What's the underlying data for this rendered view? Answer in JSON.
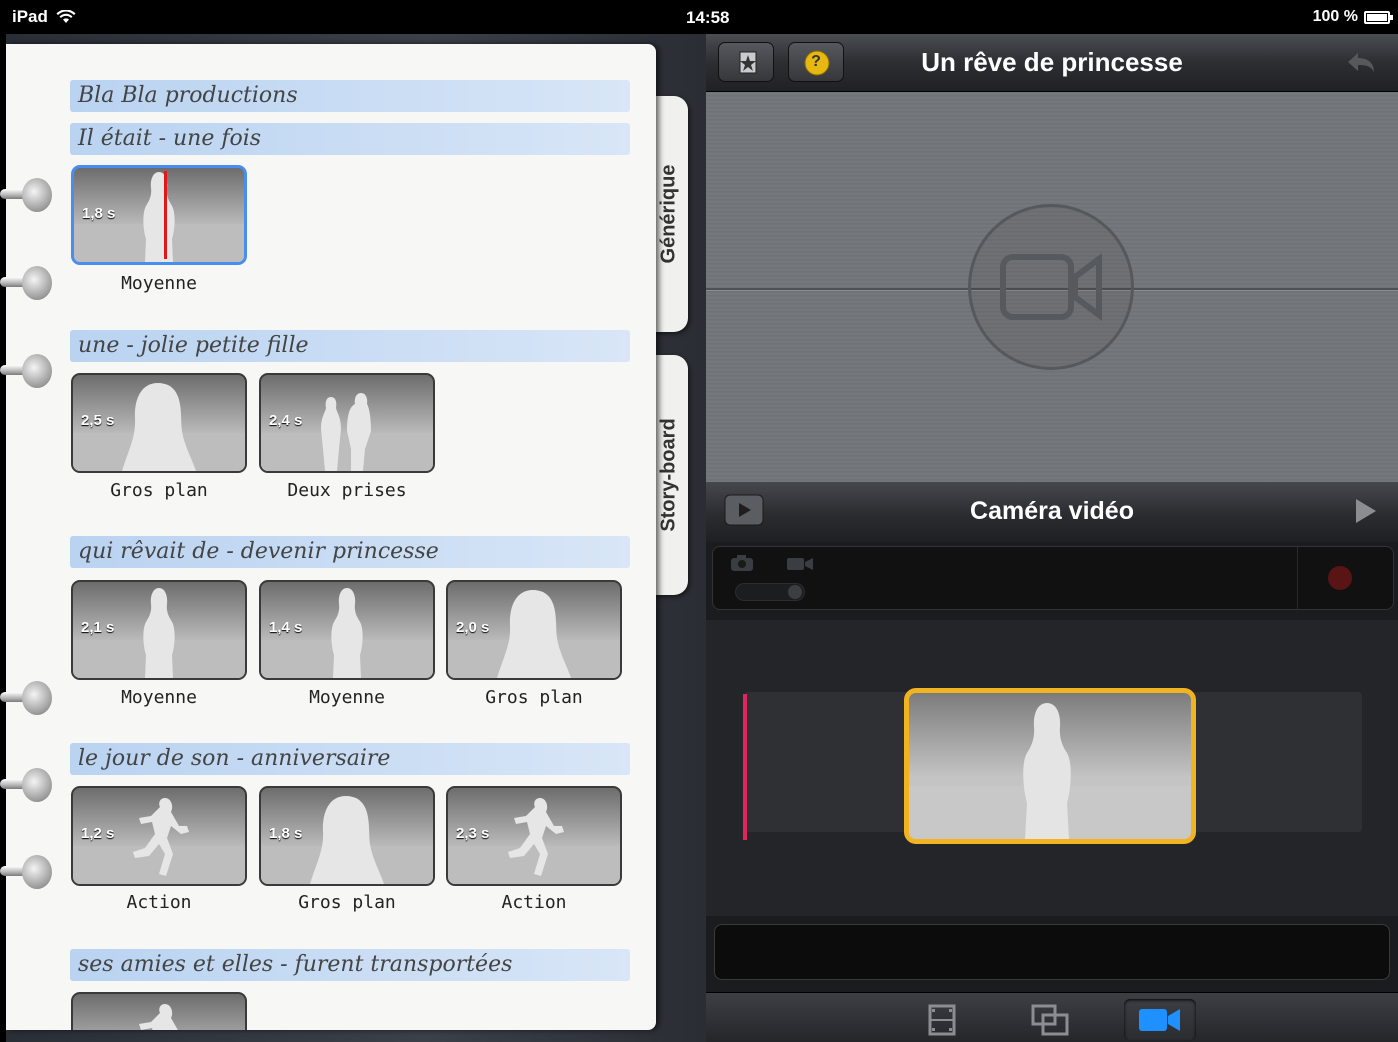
{
  "status_bar": {
    "device": "iPad",
    "time": "14:58",
    "battery": "100 %"
  },
  "notebook": {
    "tabs": [
      "Générique",
      "Story-board"
    ],
    "scenes": [
      {
        "title": "Bla Bla productions",
        "shots": []
      },
      {
        "title": "Il était - une fois",
        "shots": [
          {
            "duration": "1,8 s",
            "label": "Moyenne",
            "figure": "silhouette-full"
          }
        ]
      },
      {
        "title": "une - jolie petite fille",
        "shots": [
          {
            "duration": "2,5 s",
            "label": "Gros plan",
            "figure": "silhouette-head"
          },
          {
            "duration": "2,4 s",
            "label": "Deux prises",
            "figure": "silhouette-two"
          }
        ]
      },
      {
        "title": "qui rêvait de - devenir princesse",
        "shots": [
          {
            "duration": "2,1 s",
            "label": "Moyenne",
            "figure": "silhouette-full"
          },
          {
            "duration": "1,4 s",
            "label": "Moyenne",
            "figure": "silhouette-full"
          },
          {
            "duration": "2,0 s",
            "label": "Gros plan",
            "figure": "silhouette-head"
          }
        ]
      },
      {
        "title": "le jour de son - anniversaire",
        "shots": [
          {
            "duration": "1,2 s",
            "label": "Action",
            "figure": "silhouette-run"
          },
          {
            "duration": "1,8 s",
            "label": "Gros plan",
            "figure": "silhouette-head"
          },
          {
            "duration": "2,3 s",
            "label": "Action",
            "figure": "silhouette-run"
          }
        ]
      },
      {
        "title": "ses amies et elles - furent transportées",
        "shots": []
      }
    ]
  },
  "editor": {
    "project_title": "Un rêve de princesse",
    "help_label": "?",
    "mode_title": "Caméra vidéo",
    "icons": {
      "star": "star-document-icon",
      "help": "help-icon",
      "undo": "undo-icon",
      "camera": "video-camera-icon",
      "play": "play-icon",
      "next": "next-arrow-icon",
      "record": "record-icon"
    },
    "colors": {
      "selection": "#f2b320",
      "playhead": "#e0245c",
      "active_tab": "#1e90ff"
    }
  }
}
